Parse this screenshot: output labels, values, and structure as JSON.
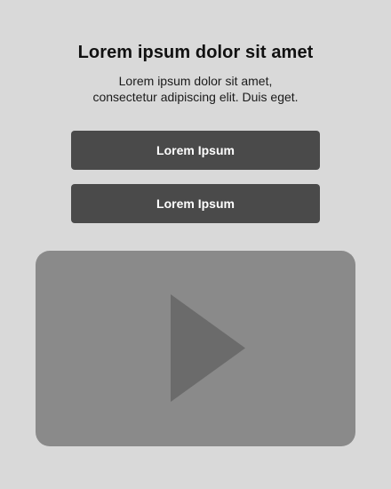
{
  "header": {
    "title": "Lorem ipsum dolor sit amet",
    "subtitle_line1": "Lorem ipsum dolor sit amet,",
    "subtitle_line2": "consectetur adipiscing elit. Duis eget."
  },
  "buttons": {
    "primary_label": "Lorem Ipsum",
    "secondary_label": "Lorem Ipsum"
  },
  "video": {
    "icon": "play-icon"
  },
  "colors": {
    "background": "#d9d9d9",
    "button": "#4a4a4a",
    "video_bg": "#8a8a8a",
    "play_icon": "#6b6b6b"
  }
}
